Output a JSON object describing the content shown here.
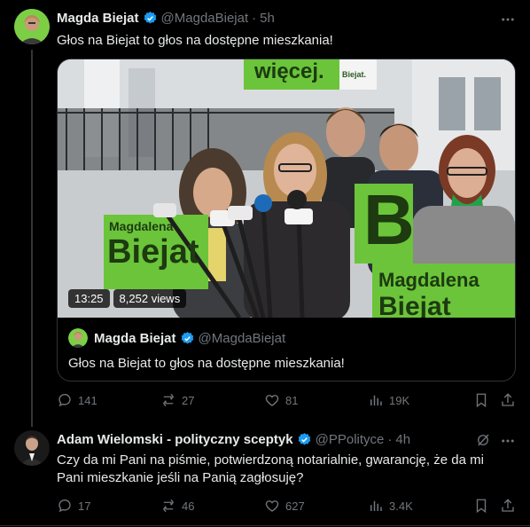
{
  "post": {
    "author_name": "Magda Biejat",
    "author_handle": "@MagdaBiejat",
    "separator": "·",
    "time": "5h",
    "text": "Głos na Biejat to głos na dostępne mieszkania!",
    "video": {
      "duration": "13:25",
      "views": "8,252 views",
      "sign_top": "więcej.",
      "sign_top_brand": "Biejat.",
      "sign_left": "Biejat",
      "sign_left_top": "Magdalena",
      "sign_center": "B",
      "sign_right_top": "Magdalena",
      "sign_right_bottom": "Biejat"
    },
    "quoted": {
      "author_name": "Magda Biejat",
      "author_handle": "@MagdaBiejat",
      "text": "Głos na Biejat to głos na dostępne mieszkania!"
    },
    "actions": {
      "replies": "141",
      "reposts": "27",
      "likes": "81",
      "views": "19K"
    }
  },
  "reply": {
    "author_name": "Adam Wielomski - polityczny sceptyk",
    "author_handle": "@PPolityce",
    "separator": "·",
    "time": "4h",
    "text": "Czy da mi Pani na piśmie, potwierdzoną notarialnie, gwarancję, że da mi Pani mieszkanie jeśli na Panią zagłosuję?",
    "actions": {
      "replies": "17",
      "reposts": "46",
      "likes": "627",
      "views": "3.4K"
    }
  },
  "colors": {
    "background": "#000000",
    "text": "#e7e9ea",
    "secondary": "#71767b",
    "verified": "#1d9bf0",
    "campaign_green": "#6bc43a",
    "border": "#2f3336"
  }
}
